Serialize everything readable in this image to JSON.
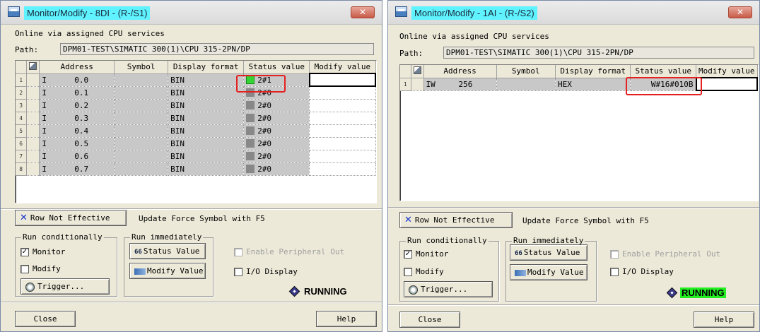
{
  "left": {
    "title": "Monitor/Modify - 8DI - (R-/S1)",
    "close_glyph": "✕",
    "online": "Online via assigned CPU services",
    "path_label": "Path:",
    "path": "DPM01-TEST\\SIMATIC 300(1)\\CPU 315-2PN/DP",
    "columns": [
      "Address",
      "Symbol",
      "Display format",
      "Status value",
      "Modify value"
    ],
    "rows": [
      {
        "num": "1",
        "type": "I",
        "addr": "0.0",
        "symbol": "",
        "format": "BIN",
        "status": "2#1",
        "led": "on"
      },
      {
        "num": "2",
        "type": "I",
        "addr": "0.1",
        "symbol": "",
        "format": "BIN",
        "status": "2#0",
        "led": "off"
      },
      {
        "num": "3",
        "type": "I",
        "addr": "0.2",
        "symbol": "",
        "format": "BIN",
        "status": "2#0",
        "led": "off"
      },
      {
        "num": "4",
        "type": "I",
        "addr": "0.3",
        "symbol": "",
        "format": "BIN",
        "status": "2#0",
        "led": "off"
      },
      {
        "num": "5",
        "type": "I",
        "addr": "0.4",
        "symbol": "",
        "format": "BIN",
        "status": "2#0",
        "led": "off"
      },
      {
        "num": "6",
        "type": "I",
        "addr": "0.5",
        "symbol": "",
        "format": "BIN",
        "status": "2#0",
        "led": "off"
      },
      {
        "num": "7",
        "type": "I",
        "addr": "0.6",
        "symbol": "",
        "format": "BIN",
        "status": "2#0",
        "led": "off"
      },
      {
        "num": "8",
        "type": "I",
        "addr": "0.7",
        "symbol": "",
        "format": "BIN",
        "status": "2#0",
        "led": "off"
      }
    ],
    "row_not_effective": "Row Not Effective",
    "update_force": "Update Force Symbol with F5",
    "run_conditionally": "Run conditionally",
    "monitor": "Monitor",
    "modify": "Modify",
    "trigger": "Trigger...",
    "run_immediately": "Run immediately",
    "status_value_btn": "Status Value",
    "modify_value_btn": "Modify Value",
    "enable_peripheral": "Enable Peripheral Out",
    "io_display": "I/O Display",
    "running": "RUNNING",
    "close": "Close",
    "help": "Help",
    "check_mark": "✓"
  },
  "right": {
    "title": "Monitor/Modify - 1AI - (R-/S2)",
    "close_glyph": "✕",
    "online": "Online via assigned CPU services",
    "path_label": "Path:",
    "path": "DPM01-TEST\\SIMATIC 300(1)\\CPU 315-2PN/DP",
    "columns": [
      "Address",
      "Symbol",
      "Display format",
      "Status value",
      "Modify value"
    ],
    "rows": [
      {
        "num": "1",
        "type": "IW",
        "addr": "256",
        "symbol": "",
        "format": "HEX",
        "status": "W#16#010B"
      }
    ],
    "row_not_effective": "Row Not Effective",
    "update_force": "Update Force Symbol with F5",
    "run_conditionally": "Run conditionally",
    "monitor": "Monitor",
    "modify": "Modify",
    "trigger": "Trigger...",
    "run_immediately": "Run immediately",
    "status_value_btn": "Status Value",
    "modify_value_btn": "Modify Value",
    "enable_peripheral": "Enable Peripheral Out",
    "io_display": "I/O Display",
    "running": "RUNNING",
    "running_highlight": "#22ee22",
    "close": "Close",
    "help": "Help",
    "check_mark": "✓"
  }
}
